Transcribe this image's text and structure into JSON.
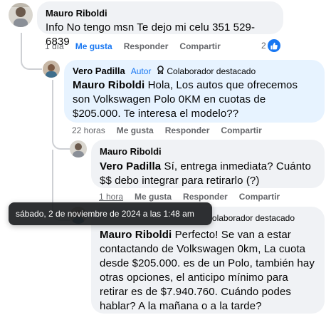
{
  "comments": [
    {
      "author": "Mauro Riboldi",
      "text": "Info No tengo msn Te dejo mi celu 351 529-6839",
      "time": "1 día",
      "like": "Me gusta",
      "reply": "Responder",
      "share": "Compartir",
      "reactions": "2"
    },
    {
      "author": "Vero Padilla",
      "author_badge": "Autor",
      "featured_badge": "Colaborador destacado",
      "mention": "Mauro Riboldi",
      "text": " Hola, Los autos que ofrecemos son Volkswagen Polo 0KM en cuotas de $205.000. Te interesa el modelo??",
      "time": "22 horas",
      "like": "Me gusta",
      "reply": "Responder",
      "share": "Compartir"
    },
    {
      "author": "Mauro Riboldi",
      "mention": "Vero Padilla",
      "text": " Sí, entrega inmediata? Cuánto $$ debo integrar para retirarlo (?)",
      "time": "1 hora",
      "like": "Me gusta",
      "reply": "Responder",
      "share": "Compartir"
    },
    {
      "featured_badge_partial": "olaborador destacado",
      "mention": "Mauro Riboldi",
      "text": " Perfecto! Se van a estar contactando de Volkswagen 0km, La cuota desde $205.000. es de un Polo, también hay otras opciones, el anticipo mínimo para retirar es de $7.940.760. Cuándo podes hablar? A la mañana o a la tarde?"
    }
  ],
  "tooltip": "sábado, 2 de noviembre de 2024 a las 1:48 am",
  "colors": {
    "accent": "#1877f2",
    "bubble_gray": "#f0f2f5",
    "bubble_blue": "#e7f3ff",
    "meta": "#65676b"
  }
}
